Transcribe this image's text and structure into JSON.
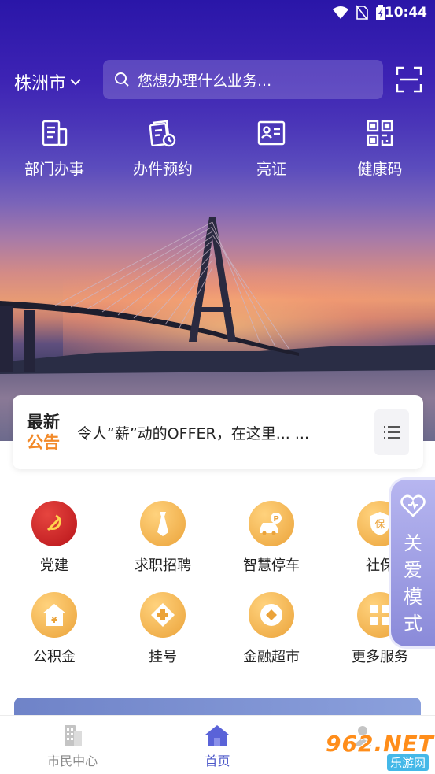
{
  "status_bar": {
    "time": "10:44"
  },
  "header": {
    "city": "株洲市",
    "search_placeholder": "您想办理什么业务..."
  },
  "quick_entries": [
    {
      "label": "部门办事",
      "icon": "document-icon"
    },
    {
      "label": "办件预约",
      "icon": "appointment-icon"
    },
    {
      "label": "亮证",
      "icon": "id-card-icon"
    },
    {
      "label": "健康码",
      "icon": "qr-code-icon"
    }
  ],
  "notice": {
    "tag_line1": "最新",
    "tag_line2": "公告",
    "text": "令人“薪”动的OFFER，在这里... ..."
  },
  "services": [
    {
      "label": "党建",
      "icon": "party-emblem-icon",
      "color": "#d32027"
    },
    {
      "label": "求职招聘",
      "icon": "tie-icon",
      "color": "#f0aa42"
    },
    {
      "label": "智慧停车",
      "icon": "parking-car-icon",
      "color": "#f0aa42"
    },
    {
      "label": "社保",
      "icon": "shield-icon",
      "color": "#f0aa42"
    },
    {
      "label": "公积金",
      "icon": "house-fund-icon",
      "color": "#f0aa42"
    },
    {
      "label": "挂号",
      "icon": "medical-cross-icon",
      "color": "#f0aa42"
    },
    {
      "label": "金融超市",
      "icon": "coin-icon",
      "color": "#f0aa42"
    },
    {
      "label": "更多服务",
      "icon": "grid-icon",
      "color": "#f0aa42"
    }
  ],
  "care_mode": {
    "label": "关爱模式"
  },
  "bottom_nav": [
    {
      "label": "市民中心",
      "icon": "building-icon",
      "active": false
    },
    {
      "label": "首页",
      "icon": "home-icon",
      "active": true
    }
  ],
  "watermark": {
    "brand": "962.NET",
    "sub": "乐游网"
  }
}
